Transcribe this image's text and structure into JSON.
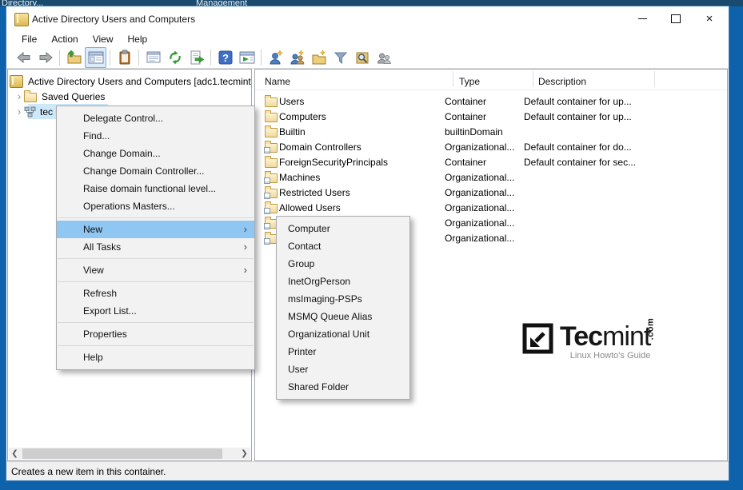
{
  "desktop": {
    "bg_title_left": "Directory...",
    "bg_title_right": "Management"
  },
  "titlebar": {
    "title": "Active Directory Users and Computers",
    "close_glyph": "×"
  },
  "menubar": {
    "items": [
      "File",
      "Action",
      "View",
      "Help"
    ]
  },
  "toolbar": {
    "icons": [
      "back-arrow",
      "forward-arrow",
      "open-parent-folder",
      "console-tree-toggle",
      "clipboard",
      "list-window",
      "refresh",
      "export-list",
      "help",
      "console-window",
      "new-user",
      "new-group",
      "new-organizational-unit",
      "filter",
      "find",
      "advanced-users"
    ]
  },
  "tree": {
    "expander_glyph": "›",
    "root_label": "Active Directory Users and Computers [adc1.tecmint.",
    "items": [
      {
        "label": "Saved Queries",
        "icon": "folder"
      },
      {
        "label": "tec",
        "icon": "domain",
        "selected": true
      }
    ]
  },
  "list": {
    "columns": [
      "Name",
      "Type",
      "Description"
    ],
    "rows": [
      {
        "name": "Users",
        "icon": "folder",
        "type": "Container",
        "description": "Default container for up..."
      },
      {
        "name": "Computers",
        "icon": "folder",
        "type": "Container",
        "description": "Default container for up..."
      },
      {
        "name": "Builtin",
        "icon": "folder",
        "type": "builtinDomain",
        "description": ""
      },
      {
        "name": "Domain Controllers",
        "icon": "organizational-unit",
        "type": "Organizational...",
        "description": "Default container for do..."
      },
      {
        "name": "ForeignSecurityPrincipals",
        "icon": "folder",
        "type": "Container",
        "description": "Default container for sec..."
      },
      {
        "name": "Machines",
        "icon": "organizational-unit",
        "type": "Organizational...",
        "description": ""
      },
      {
        "name": "Restricted Users",
        "icon": "organizational-unit",
        "type": "Organizational...",
        "description": ""
      },
      {
        "name": "Allowed Users",
        "icon": "organizational-unit",
        "type": "Organizational...",
        "description": ""
      },
      {
        "name": "",
        "icon": "organizational-unit",
        "type": "Organizational...",
        "description": ""
      },
      {
        "name": "",
        "icon": "organizational-unit",
        "type": "Organizational...",
        "description": ""
      }
    ]
  },
  "context_menu": {
    "chevron": "›",
    "items": [
      {
        "label": "Delegate Control..."
      },
      {
        "label": "Find..."
      },
      {
        "label": "Change Domain..."
      },
      {
        "label": "Change Domain Controller..."
      },
      {
        "label": "Raise domain functional level..."
      },
      {
        "label": "Operations Masters..."
      },
      {
        "label": "New",
        "submenu": true,
        "highlighted": true
      },
      {
        "label": "All Tasks",
        "submenu": true
      },
      {
        "label": "View",
        "submenu": true
      },
      {
        "label": "Refresh"
      },
      {
        "label": "Export List..."
      },
      {
        "label": "Properties"
      },
      {
        "label": "Help"
      }
    ]
  },
  "submenu": {
    "items": [
      "Computer",
      "Contact",
      "Group",
      "InetOrgPerson",
      "msImaging-PSPs",
      "MSMQ Queue Alias",
      "Organizational Unit",
      "Printer",
      "User",
      "Shared Folder"
    ]
  },
  "statusbar": {
    "text": "Creates a new item in this container."
  },
  "watermark": {
    "brand_bold": "Tec",
    "brand_light": "mint",
    "tld": ".com",
    "tagline": "Linux Howto's Guide"
  },
  "colors": {
    "accent_blue": "#0d62ab",
    "menu_highlight": "#8fc6f2",
    "tree_selection": "#cde8f8"
  }
}
